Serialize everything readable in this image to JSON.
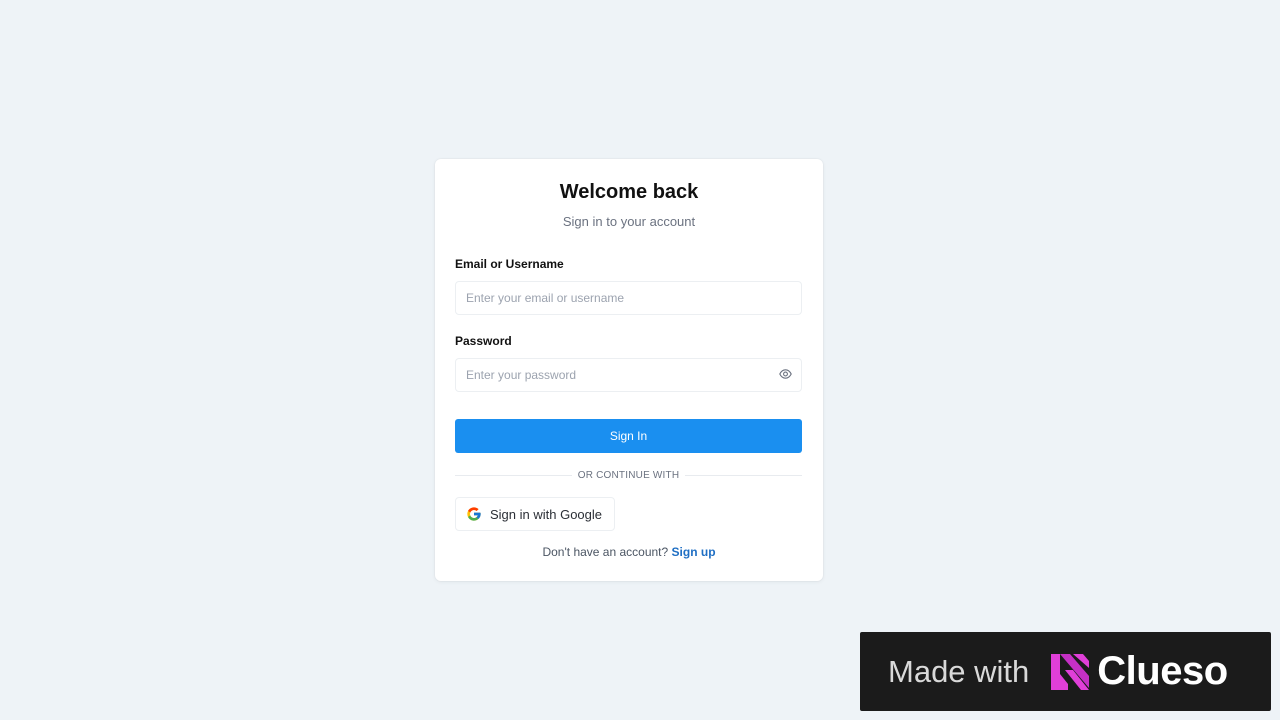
{
  "login": {
    "title": "Welcome back",
    "subtitle": "Sign in to your account",
    "email_label": "Email or Username",
    "email_placeholder": "Enter your email or username",
    "email_value": "",
    "password_label": "Password",
    "password_placeholder": "Enter your password",
    "password_value": "",
    "password_toggle_icon": "eye-icon",
    "signin_label": "Sign In",
    "divider_text": "OR CONTINUE WITH",
    "google_label": "Sign in with Google",
    "google_icon": "google-icon",
    "signup_prompt": "Don't have an account?",
    "signup_link": "Sign up"
  },
  "watermark": {
    "made_with": "Made with",
    "brand": "Clueso",
    "logo_icon": "clueso-logo-icon"
  },
  "colors": {
    "background": "#eef3f7",
    "primary_button": "#1a8ff0",
    "link": "#1f6fc4",
    "watermark_bg": "#1b1b1b",
    "brand_accent": "#e03fd8"
  }
}
